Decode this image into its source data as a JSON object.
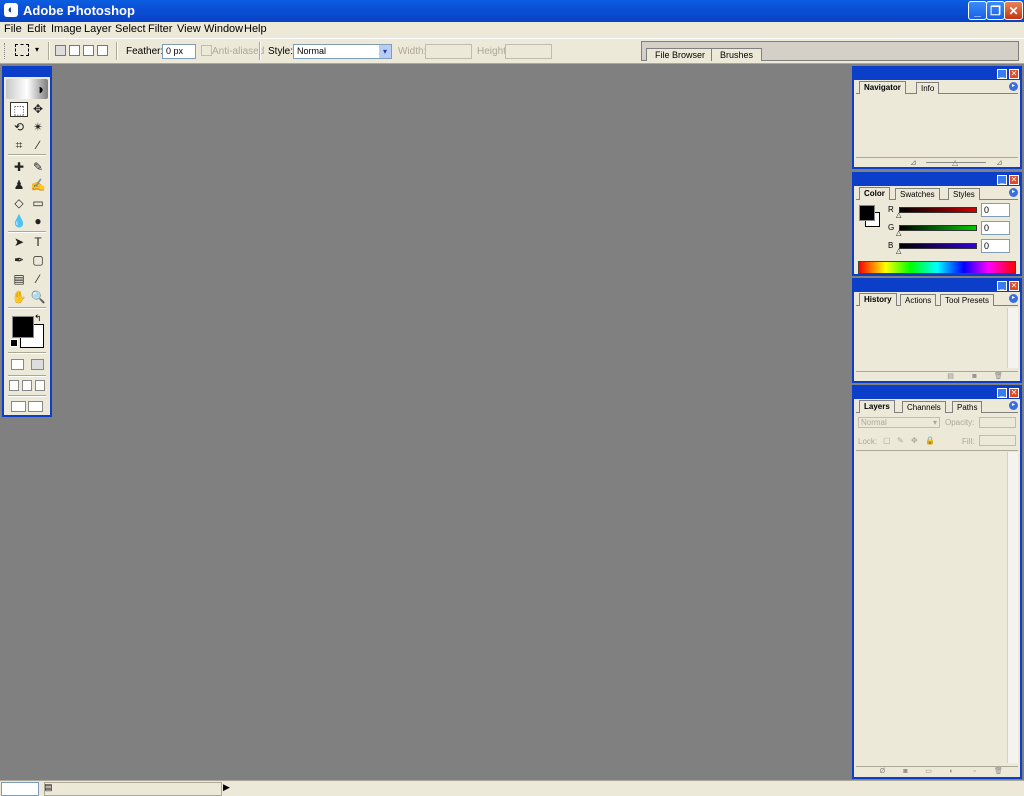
{
  "window": {
    "title": "Adobe Photoshop",
    "app_icon": "photoshop-eye-icon",
    "minimize_glyph": "_",
    "restore_glyph": "❐",
    "close_glyph": "✕"
  },
  "menu": [
    "File",
    "Edit",
    "Image",
    "Layer",
    "Select",
    "Filter",
    "View",
    "Window",
    "Help"
  ],
  "options_bar": {
    "feather_label": "Feather:",
    "feather_value": "0 px",
    "anti_aliased_label": "Anti-aliased",
    "style_label": "Style:",
    "style_value": "Normal",
    "width_label": "Width:",
    "height_label": "Height:",
    "palette_well_tabs": [
      "File Browser",
      "Brushes"
    ]
  },
  "toolbox": {
    "tools": [
      {
        "name": "rectangular-marquee-tool",
        "glyph": "⬚"
      },
      {
        "name": "move-tool",
        "glyph": "✥"
      },
      {
        "name": "lasso-tool",
        "glyph": "⟲"
      },
      {
        "name": "magic-wand-tool",
        "glyph": "✴"
      },
      {
        "name": "crop-tool",
        "glyph": "⌗"
      },
      {
        "name": "slice-tool",
        "glyph": "∕"
      },
      {
        "name": "healing-brush-tool",
        "glyph": "✚"
      },
      {
        "name": "brush-tool",
        "glyph": "✎"
      },
      {
        "name": "clone-stamp-tool",
        "glyph": "♟"
      },
      {
        "name": "history-brush-tool",
        "glyph": "✍"
      },
      {
        "name": "eraser-tool",
        "glyph": "◇"
      },
      {
        "name": "gradient-tool",
        "glyph": "▭"
      },
      {
        "name": "blur-tool",
        "glyph": "💧"
      },
      {
        "name": "dodge-tool",
        "glyph": "●"
      },
      {
        "name": "path-selection-tool",
        "glyph": "➤"
      },
      {
        "name": "type-tool",
        "glyph": "T"
      },
      {
        "name": "pen-tool",
        "glyph": "✒"
      },
      {
        "name": "shape-tool",
        "glyph": "▢"
      },
      {
        "name": "notes-tool",
        "glyph": "▤"
      },
      {
        "name": "eyedropper-tool",
        "glyph": "⁄"
      },
      {
        "name": "hand-tool",
        "glyph": "✋"
      },
      {
        "name": "zoom-tool",
        "glyph": "🔍"
      }
    ]
  },
  "navigator_palette": {
    "tabs": [
      "Navigator",
      "Info"
    ]
  },
  "color_palette": {
    "tabs": [
      "Color",
      "Swatches",
      "Styles"
    ],
    "channels": [
      {
        "label": "R",
        "value": "0",
        "color": "#cc0000"
      },
      {
        "label": "G",
        "value": "0",
        "color": "#00aa00"
      },
      {
        "label": "B",
        "value": "0",
        "color": "#2200cc"
      }
    ]
  },
  "history_palette": {
    "tabs": [
      "History",
      "Actions",
      "Tool Presets"
    ]
  },
  "layers_palette": {
    "tabs": [
      "Layers",
      "Channels",
      "Paths"
    ],
    "blend_mode": "Normal",
    "opacity_label": "Opacity:",
    "lock_label": "Lock:",
    "fill_label": "Fill:"
  },
  "colors": {
    "accent": "#0b3ec9",
    "canvas": "#808080",
    "chrome": "#ece9d8"
  }
}
